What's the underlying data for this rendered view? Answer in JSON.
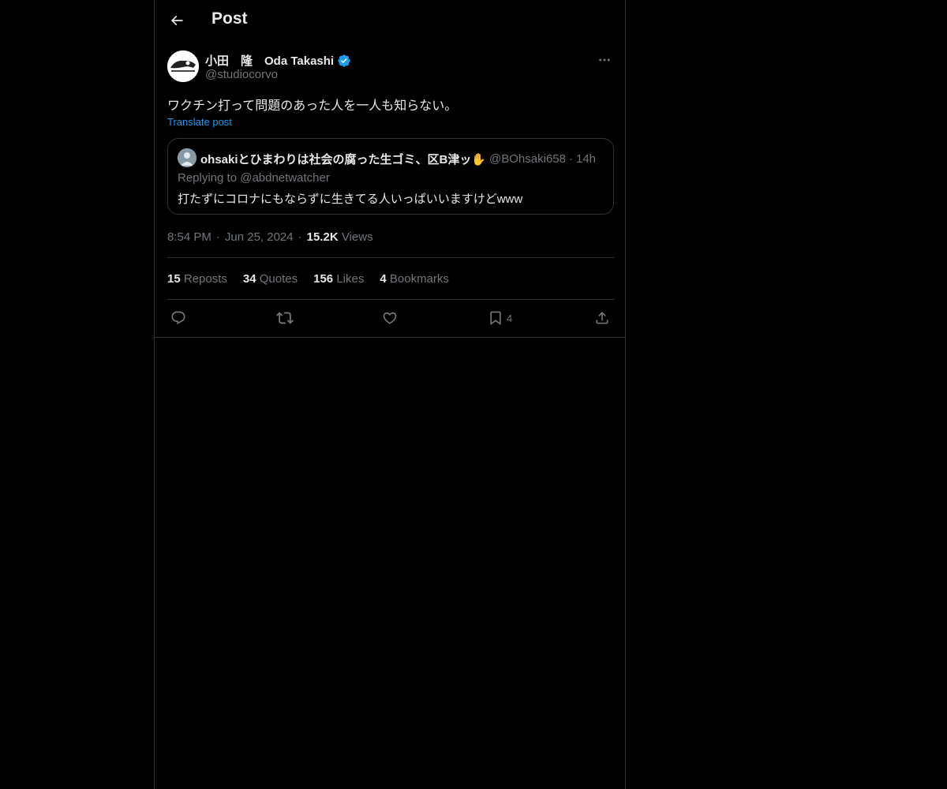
{
  "header": {
    "title": "Post",
    "back_icon": "arrow-left-icon"
  },
  "author": {
    "name": "小田　隆　Oda Takashi",
    "handle": "@studiocorvo",
    "verified": true,
    "verified_color": "#1d9bf0"
  },
  "post": {
    "text": "ワクチン打って問題のあった人を一人も知らない。",
    "translate_label": "Translate post"
  },
  "quote": {
    "name": "ohsakiとひまわりは社会の腐った生ゴミ、区B津ッ✋",
    "handle": "@BOhsaki658",
    "separator": "·",
    "time": "14h",
    "replying": "Replying to @abdnetwatcher",
    "text": "打たずにコロナにもならずに生きてる人いっぱいいますけどwww"
  },
  "meta": {
    "time": "8:54 PM",
    "date": "Jun 25, 2024",
    "separator": "·",
    "views_count": "15.2K",
    "views_label": "Views"
  },
  "stats": {
    "reposts_count": "15",
    "reposts_label": "Reposts",
    "quotes_count": "34",
    "quotes_label": "Quotes",
    "likes_count": "156",
    "likes_label": "Likes",
    "bookmarks_count": "4",
    "bookmarks_label": "Bookmarks"
  },
  "actions": {
    "bookmark_count": "4"
  },
  "colors": {
    "background": "#000000",
    "text": "#e7e9ea",
    "muted": "#71767b",
    "accent": "#1d9bf0",
    "border": "#2f3336"
  }
}
